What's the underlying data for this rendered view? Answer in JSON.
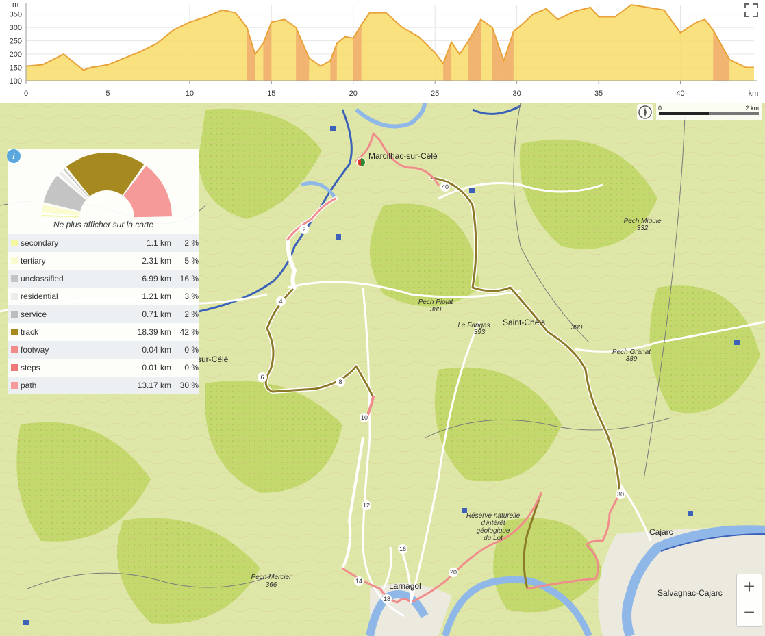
{
  "profile": {
    "y_unit": "m",
    "x_unit": "km",
    "y_ticks": [
      "350",
      "300",
      "250",
      "200",
      "150",
      "100"
    ],
    "x_ticks": [
      "0",
      "5",
      "10",
      "15",
      "20",
      "25",
      "30",
      "35",
      "40"
    ],
    "colors": {
      "fill": "#f8dc6a",
      "line": "#e9a237",
      "steep": "#e88060",
      "axis": "#9a9a9a"
    }
  },
  "chart_data": {
    "type": "area",
    "title": "",
    "xlabel": "km",
    "ylabel": "m",
    "ylim": [
      100,
      385
    ],
    "xlim": [
      0,
      44.5
    ],
    "series": [
      {
        "x": [
          0,
          1,
          1.5,
          2.3,
          3.5,
          4,
          5,
          6,
          7,
          8,
          9,
          10,
          11,
          12,
          12.8,
          13.5,
          14,
          14.5,
          15,
          15.8,
          16.5,
          17.3,
          18,
          18.6,
          19,
          19.5,
          20,
          20.5,
          21,
          22,
          23,
          24,
          25,
          25.5,
          26,
          26.5,
          27,
          27.8,
          28.5,
          29.2,
          29.8,
          30.3,
          31,
          31.8,
          32.5,
          33.5,
          34.5,
          35,
          36,
          37,
          38,
          39,
          40,
          41,
          41.5,
          42,
          43,
          44,
          44.5
        ],
        "y": [
          155,
          160,
          175,
          200,
          140,
          150,
          160,
          185,
          210,
          240,
          290,
          320,
          340,
          365,
          355,
          300,
          200,
          240,
          320,
          330,
          300,
          185,
          155,
          175,
          240,
          265,
          260,
          310,
          355,
          355,
          300,
          265,
          205,
          165,
          245,
          200,
          245,
          330,
          300,
          175,
          285,
          310,
          350,
          370,
          330,
          360,
          375,
          340,
          340,
          385,
          375,
          365,
          280,
          320,
          330,
          290,
          180,
          150,
          150
        ]
      }
    ]
  },
  "map": {
    "places": [
      {
        "label": "Pech Miqule",
        "sub": "332"
      },
      {
        "label": "Pech Piolat",
        "sub": "380"
      },
      {
        "label": "Le Fangas",
        "sub": "393"
      },
      {
        "label": "Pech Granat",
        "sub": "389"
      },
      {
        "label": "Pech Mercier",
        "sub": "366"
      },
      {
        "label": "390",
        "sub": ""
      }
    ],
    "towns": [
      "Marcilhac-sur-Célé",
      "Saint-Chels",
      "sur-Célé",
      "Cajarc",
      "Salvagnac-Cajarc",
      "Larnagol"
    ],
    "nature_reserve": [
      "Réserve naturelle",
      "d'intérêt",
      "géologique",
      "du Lot"
    ],
    "km_markers": [
      "2",
      "4",
      "6",
      "8",
      "10",
      "12",
      "14",
      "16",
      "18",
      "20",
      "30",
      "40"
    ],
    "scale": {
      "zero": "0",
      "end": "2 km"
    },
    "zoom_in": "+",
    "zoom_out": "−",
    "colors": {
      "terrain": "#dfe7a8",
      "forest": "#c3d86a",
      "river": "#8fb8e8",
      "river_dark": "#3b62b8",
      "track": "#8d7a28",
      "path": "#f08c8c",
      "road": "#ffffff"
    }
  },
  "stats": {
    "info_symbol": "i",
    "hide_label": "Ne plus afficher sur la carte",
    "rows": [
      {
        "name": "secondary",
        "dist": "1.1 km",
        "pct": "2 %",
        "pct_value": 2,
        "color": "#f2f7a0"
      },
      {
        "name": "tertiary",
        "dist": "2.31 km",
        "pct": "5 %",
        "pct_value": 5,
        "color": "#fbfbd0"
      },
      {
        "name": "unclassified",
        "dist": "6.99 km",
        "pct": "16 %",
        "pct_value": 16,
        "color": "#c4c4c4"
      },
      {
        "name": "residential",
        "dist": "1.21 km",
        "pct": "3 %",
        "pct_value": 3,
        "color": "#ececec"
      },
      {
        "name": "service",
        "dist": "0.71 km",
        "pct": "2 %",
        "pct_value": 2,
        "color": "#bdbdbd"
      },
      {
        "name": "track",
        "dist": "18.39 km",
        "pct": "42 %",
        "pct_value": 42,
        "color": "#a68a20"
      },
      {
        "name": "footway",
        "dist": "0.04 km",
        "pct": "0 %",
        "pct_value": 0,
        "color": "#f28a8a"
      },
      {
        "name": "steps",
        "dist": "0.01 km",
        "pct": "0 %",
        "pct_value": 0,
        "color": "#f07878"
      },
      {
        "name": "path",
        "dist": "13.17 km",
        "pct": "30 %",
        "pct_value": 30,
        "color": "#f59a98"
      }
    ]
  }
}
